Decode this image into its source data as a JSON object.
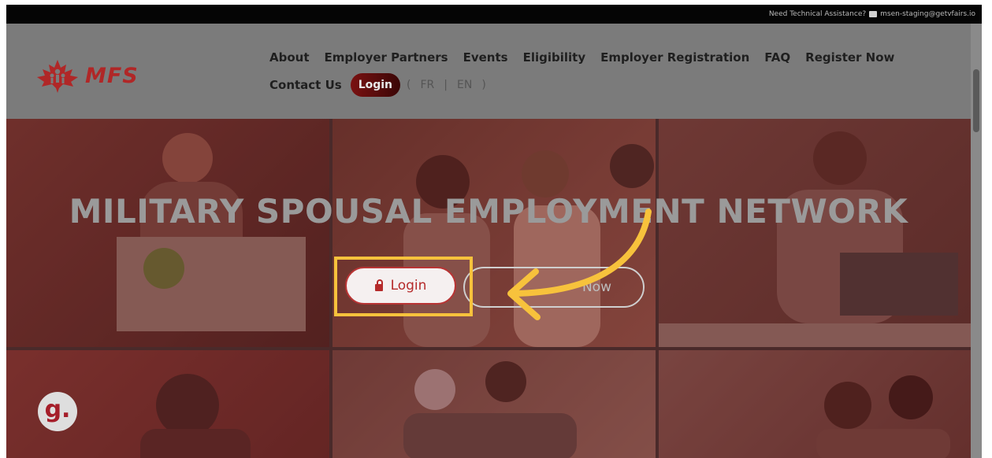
{
  "topbar": {
    "assist_text": "Need Technical Assistance?",
    "email": "msen-staging@getvfairs.io"
  },
  "logo": {
    "text": "MFS"
  },
  "nav": {
    "row1": [
      "About",
      "Employer Partners",
      "Events",
      "Eligibility",
      "Employer Registration",
      "FAQ",
      "Register Now"
    ],
    "contact": "Contact Us",
    "login": "Login",
    "lang_open": "(",
    "lang_fr": "FR",
    "lang_sep": "|",
    "lang_en": "EN",
    "lang_close": ")"
  },
  "hero": {
    "title": "MILITARY SPOUSAL EMPLOYMENT NETWORK",
    "login_button": "Login",
    "register_button": "Now"
  },
  "badge": {
    "letter": "g."
  },
  "colors": {
    "brand_red": "#b02727",
    "highlight": "#f7c23c",
    "arrow": "#f7c23c"
  }
}
